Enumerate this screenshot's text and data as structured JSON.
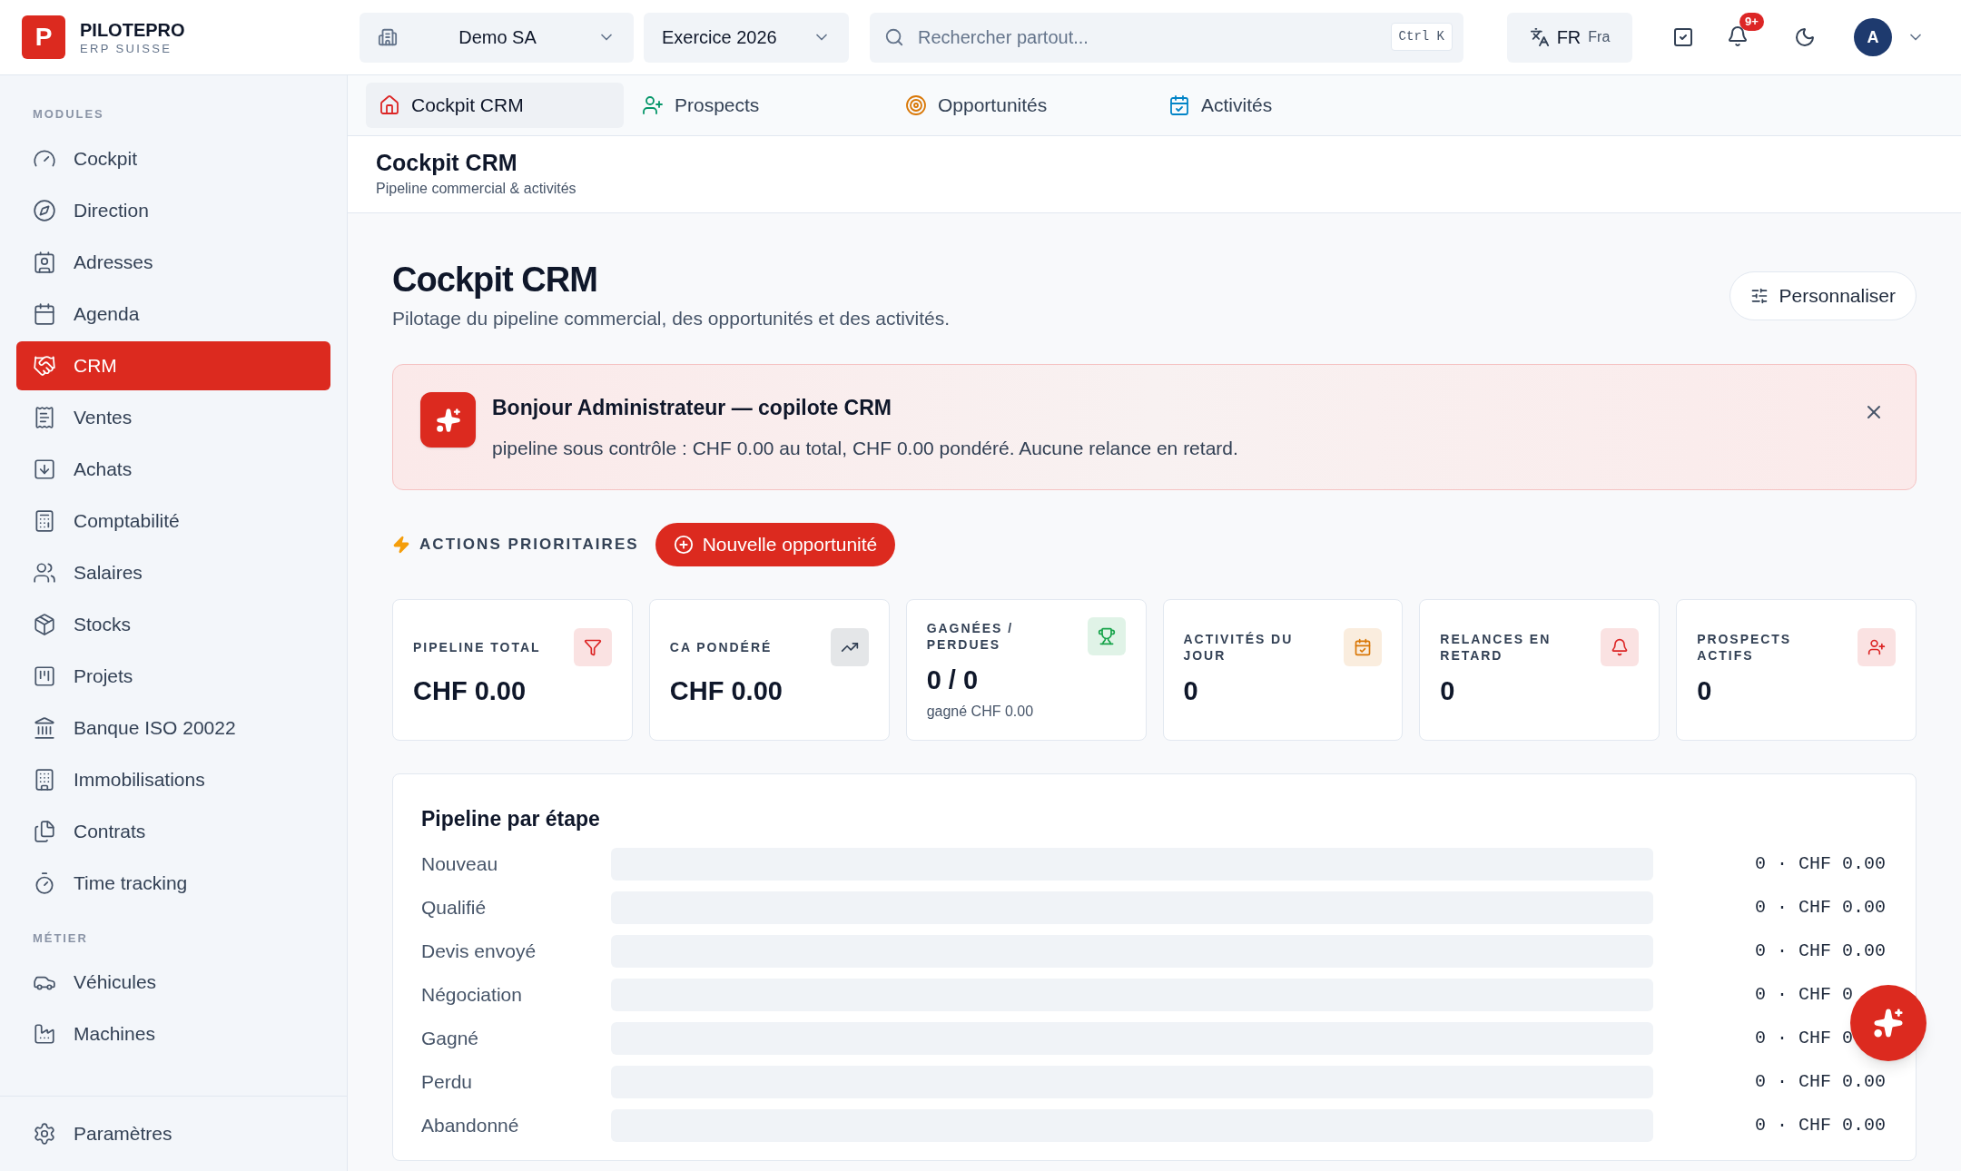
{
  "brand": {
    "logo_letter": "P",
    "name": "PILOTEPRO",
    "tagline": "ERP SUISSE"
  },
  "topbar": {
    "company": "Demo SA",
    "fiscal_year": "Exercice 2026",
    "search": {
      "placeholder": "Rechercher partout...",
      "shortcut": "Ctrl K"
    },
    "language": {
      "code": "FR",
      "name": "Fra"
    },
    "notifications_badge": "9+",
    "avatar": "A"
  },
  "sidebar": {
    "sections": [
      {
        "title": "MODULES",
        "items": [
          {
            "label": "Cockpit",
            "selected": false
          },
          {
            "label": "Direction",
            "selected": false
          },
          {
            "label": "Adresses",
            "selected": false
          },
          {
            "label": "Agenda",
            "selected": false
          },
          {
            "label": "CRM",
            "selected": true
          },
          {
            "label": "Ventes",
            "selected": false
          },
          {
            "label": "Achats",
            "selected": false
          },
          {
            "label": "Comptabilité",
            "selected": false
          },
          {
            "label": "Salaires",
            "selected": false
          },
          {
            "label": "Stocks",
            "selected": false
          },
          {
            "label": "Projets",
            "selected": false
          },
          {
            "label": "Banque ISO 20022",
            "selected": false
          },
          {
            "label": "Immobilisations",
            "selected": false
          },
          {
            "label": "Contrats",
            "selected": false
          },
          {
            "label": "Time tracking",
            "selected": false
          }
        ]
      },
      {
        "title": "MÉTIER",
        "items": [
          {
            "label": "Véhicules",
            "selected": false
          },
          {
            "label": "Machines",
            "selected": false
          }
        ]
      }
    ],
    "footer_item": {
      "label": "Paramètres",
      "selected": false
    }
  },
  "tabs": [
    {
      "label": "Cockpit CRM",
      "selected": true,
      "color": "#dc2626"
    },
    {
      "label": "Prospects",
      "selected": false,
      "color": "#059669"
    },
    {
      "label": "Opportunités",
      "selected": false,
      "color": "#d97706"
    },
    {
      "label": "Activités",
      "selected": false,
      "color": "#0284c7"
    }
  ],
  "page_header": {
    "title": "Cockpit CRM",
    "subtitle": "Pipeline commercial & activités"
  },
  "content": {
    "title": "Cockpit CRM",
    "subtitle": "Pilotage du pipeline commercial, des opportunités et des activités.",
    "customize_button": "Personnaliser",
    "banner": {
      "title": "Bonjour Administrateur — copilote CRM",
      "text": "pipeline sous contrôle : CHF 0.00 au total, CHF 0.00 pondéré. Aucune relance en retard."
    },
    "actions": {
      "label": "ACTIONS PRIORITAIRES",
      "button": "Nouvelle opportunité"
    },
    "kpis": [
      {
        "label": "PIPELINE TOTAL",
        "value": "CHF 0.00",
        "color": "#dc2626"
      },
      {
        "label": "CA PONDÉRÉ",
        "value": "CHF 0.00",
        "color": "#334155"
      },
      {
        "label": "GAGNÉES / PERDUES",
        "value": "0 / 0",
        "sub": "gagné CHF 0.00",
        "color": "#16a34a"
      },
      {
        "label": "ACTIVITÉS DU JOUR",
        "value": "0",
        "color": "#d97706"
      },
      {
        "label": "RELANCES EN RETARD",
        "value": "0",
        "color": "#dc2626"
      },
      {
        "label": "PROSPECTS ACTIFS",
        "value": "0",
        "color": "#dc2626"
      }
    ],
    "pipeline": {
      "title": "Pipeline par étape",
      "stages": [
        {
          "name": "Nouveau",
          "reading": "0 · CHF 0.00"
        },
        {
          "name": "Qualifié",
          "reading": "0 · CHF 0.00"
        },
        {
          "name": "Devis envoyé",
          "reading": "0 · CHF 0.00"
        },
        {
          "name": "Négociation",
          "reading": "0 · CHF 0"
        },
        {
          "name": "Gagné",
          "reading": "0 · CHF 0"
        },
        {
          "name": "Perdu",
          "reading": "0 · CHF 0.00"
        },
        {
          "name": "Abandonné",
          "reading": "0 · CHF 0.00"
        }
      ]
    }
  }
}
